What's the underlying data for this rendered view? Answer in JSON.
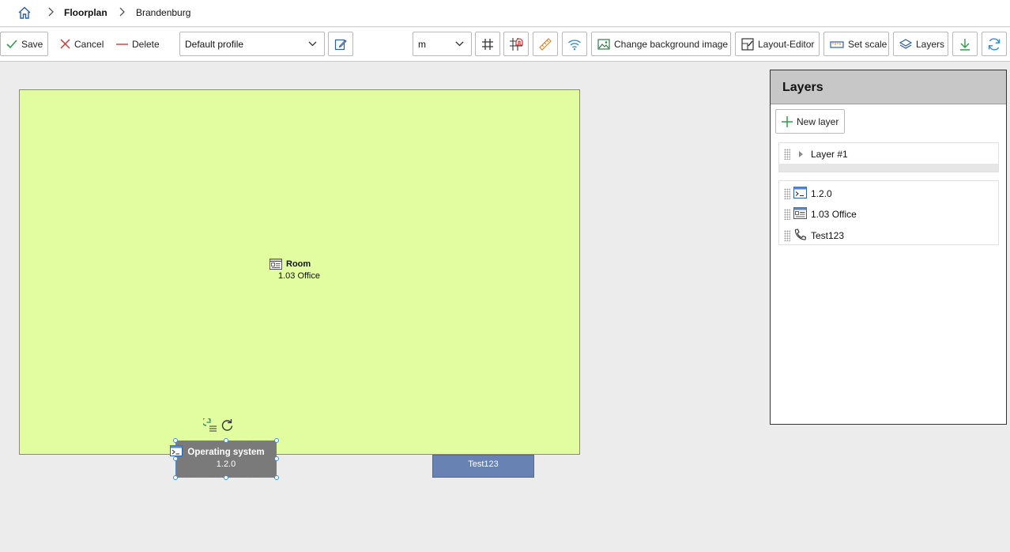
{
  "breadcrumb": {
    "items": [
      "Floorplan",
      "Brandenburg"
    ]
  },
  "toolbar": {
    "save_label": "Save",
    "cancel_label": "Cancel",
    "delete_label": "Delete",
    "profile_value": "Default profile",
    "unit_value": "m",
    "change_bg_label": "Change background image",
    "layout_editor_label": "Layout-Editor",
    "set_scale_label": "Set scale",
    "layers_label": "Layers"
  },
  "canvas": {
    "room": {
      "type_label": "Room",
      "name": "1.03 Office",
      "fill_color": "#e1fd9f"
    },
    "os_object": {
      "type_label": "Operating system",
      "name": "1.2.0"
    },
    "phone_object": {
      "name": "Test123"
    }
  },
  "layers_panel": {
    "title": "Layers",
    "new_layer_label": "New layer",
    "layers": [
      {
        "name": "Layer #1"
      }
    ],
    "objects": [
      {
        "name": "1.2.0",
        "icon": "terminal-icon"
      },
      {
        "name": "1.03 Office",
        "icon": "room-icon"
      },
      {
        "name": "Test123",
        "icon": "phone-icon"
      }
    ]
  },
  "colors": {
    "accent": "#3d8fe0",
    "os_fill": "#7a7a7a",
    "phone_fill": "#6883b3"
  }
}
